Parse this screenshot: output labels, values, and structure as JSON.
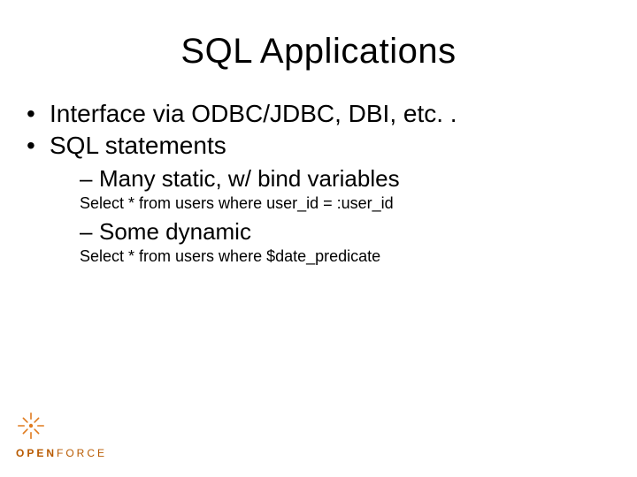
{
  "title": "SQL Applications",
  "bullets": {
    "b1": "Interface via ODBC/JDBC, DBI, etc. .",
    "b2": "SQL statements",
    "s1": "Many static, w/ bind variables",
    "code1": "Select * from users where user_id = :user_id",
    "s2": "Some dynamic",
    "code2": "Select * from users where $date_predicate"
  },
  "logo": {
    "brand_open": "OPEN",
    "brand_force": "FORCE"
  },
  "colors": {
    "logo_orange": "#e07b1f",
    "logo_text": "#b85a00"
  }
}
